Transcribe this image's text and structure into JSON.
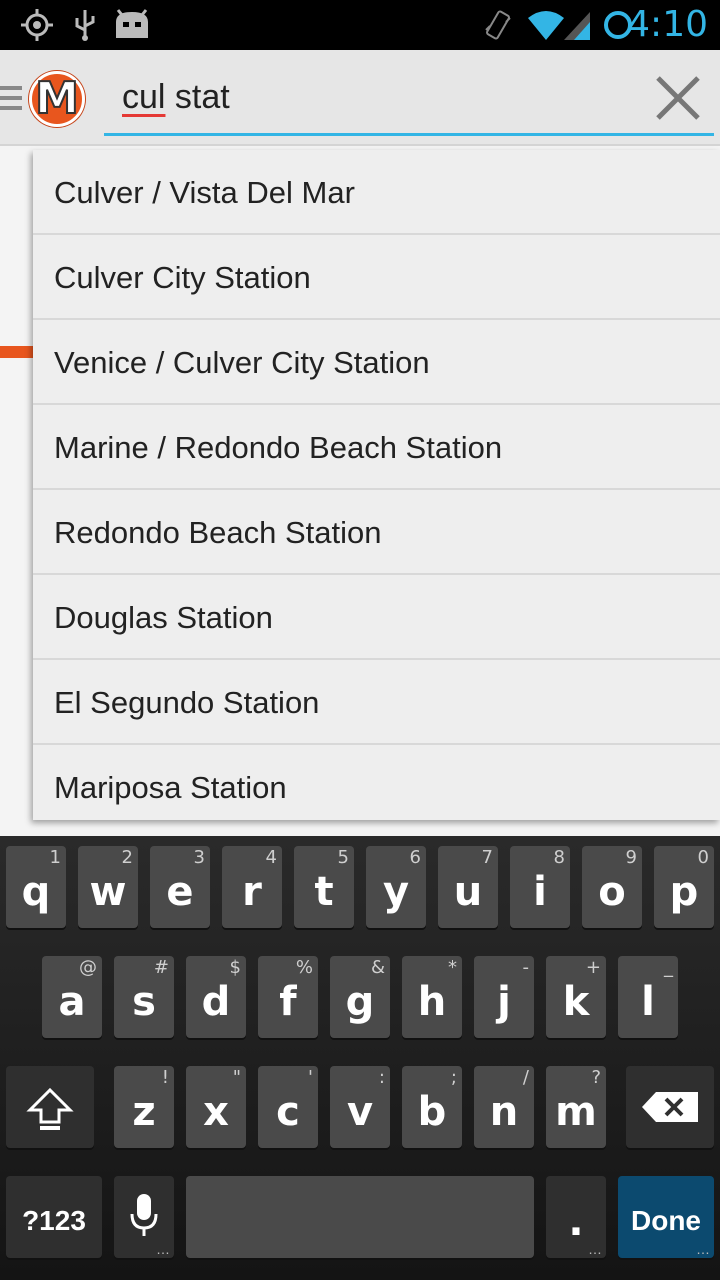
{
  "status_bar": {
    "time": "4:10",
    "icons": [
      "gps-icon",
      "usb-icon",
      "android-debug-icon",
      "vibrate-icon",
      "wifi-icon",
      "signal-icon",
      "sync-icon"
    ]
  },
  "action_bar": {
    "app_logo_letter": "M",
    "search": {
      "value_misspelled": "cul",
      "value_rest": " stat"
    }
  },
  "suggestions": [
    "Culver / Vista Del Mar",
    "Culver City Station",
    "Venice / Culver City Station",
    "Marine / Redondo Beach Station",
    "Redondo Beach Station",
    "Douglas Station",
    "El Segundo Station",
    "Mariposa Station"
  ],
  "keyboard": {
    "row1": [
      {
        "key": "q",
        "hint": "1"
      },
      {
        "key": "w",
        "hint": "2"
      },
      {
        "key": "e",
        "hint": "3"
      },
      {
        "key": "r",
        "hint": "4"
      },
      {
        "key": "t",
        "hint": "5"
      },
      {
        "key": "y",
        "hint": "6"
      },
      {
        "key": "u",
        "hint": "7"
      },
      {
        "key": "i",
        "hint": "8"
      },
      {
        "key": "o",
        "hint": "9"
      },
      {
        "key": "p",
        "hint": "0"
      }
    ],
    "row2": [
      {
        "key": "a",
        "hint": "@"
      },
      {
        "key": "s",
        "hint": "#"
      },
      {
        "key": "d",
        "hint": "$"
      },
      {
        "key": "f",
        "hint": "%"
      },
      {
        "key": "g",
        "hint": "&"
      },
      {
        "key": "h",
        "hint": "*"
      },
      {
        "key": "j",
        "hint": "-"
      },
      {
        "key": "k",
        "hint": "+"
      },
      {
        "key": "l",
        "hint": "_"
      }
    ],
    "row3": [
      {
        "key": "z",
        "hint": "!"
      },
      {
        "key": "x",
        "hint": "\""
      },
      {
        "key": "c",
        "hint": "'"
      },
      {
        "key": "v",
        "hint": ":"
      },
      {
        "key": "b",
        "hint": ";"
      },
      {
        "key": "n",
        "hint": "/"
      },
      {
        "key": "m",
        "hint": "?"
      }
    ],
    "symbols_label": "?123",
    "period_label": ".",
    "done_label": "Done"
  },
  "colors": {
    "accent": "#33b5e5",
    "brand": "#e8561e",
    "done_key": "#0c4a6f"
  }
}
